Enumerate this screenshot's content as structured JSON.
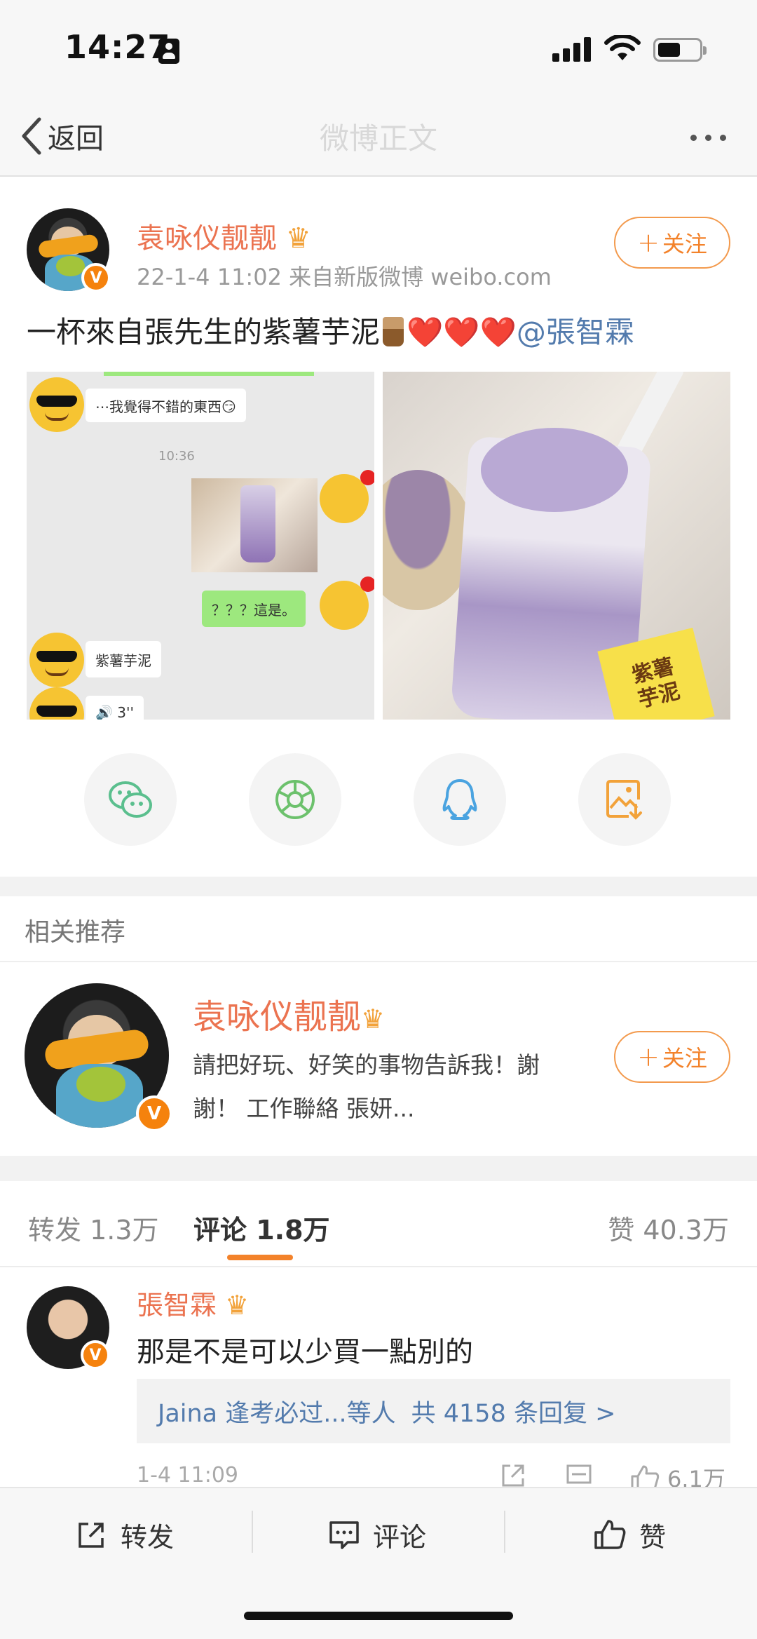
{
  "status_bar": {
    "time": "14:27",
    "battery_percent": 55
  },
  "nav": {
    "back_label": "返回",
    "title": "微博正文"
  },
  "post": {
    "author": "袁咏仪靓靓",
    "meta": "22-1-4 11:02  来自新版微博 weibo.com",
    "follow_label": "关注",
    "text_main": "一杯來自張先生的紫薯芋泥",
    "hearts": "❤️❤️❤️",
    "mention": "@張智霖",
    "chat": {
      "bubble1": "⋯我覺得不錯的東西😏",
      "time": "10:36",
      "bubble2": "？？？這是。",
      "bubble3": "紫薯芋泥",
      "bubble4": "🔊 3''"
    },
    "photo_label": "紫薯\n芋泥"
  },
  "share": {
    "icons": [
      "wechat-icon",
      "moments-icon",
      "qq-icon",
      "save-image-icon"
    ],
    "colors": {
      "wechat": "#5bbf8e",
      "moments": "#6cc16c",
      "qq": "#4aa3e0",
      "save": "#f2a23a"
    }
  },
  "recommend": {
    "section_title": "相关推荐",
    "name": "袁咏仪靓靓",
    "desc": "請把好玩、好笑的事物告訴我！謝謝！ 工作聯絡 張妍...",
    "follow_label": "关注"
  },
  "tabs": {
    "repost": "转发 1.3万",
    "comment": "评论 1.8万",
    "like": "赞 40.3万"
  },
  "comment": {
    "author": "張智霖",
    "text": "那是不是可以少買一點別的",
    "reply_summary": "Jaina 逢考必过...等人",
    "reply_count": "共 4158 条回复 >",
    "time": "1-4 11:09",
    "likes": "6.1万"
  },
  "bottom_bar": {
    "repost": "转发",
    "comment": "评论",
    "like": "赞"
  },
  "colors": {
    "accent": "#f3822a",
    "name": "#eb7350",
    "link": "#537bad"
  }
}
